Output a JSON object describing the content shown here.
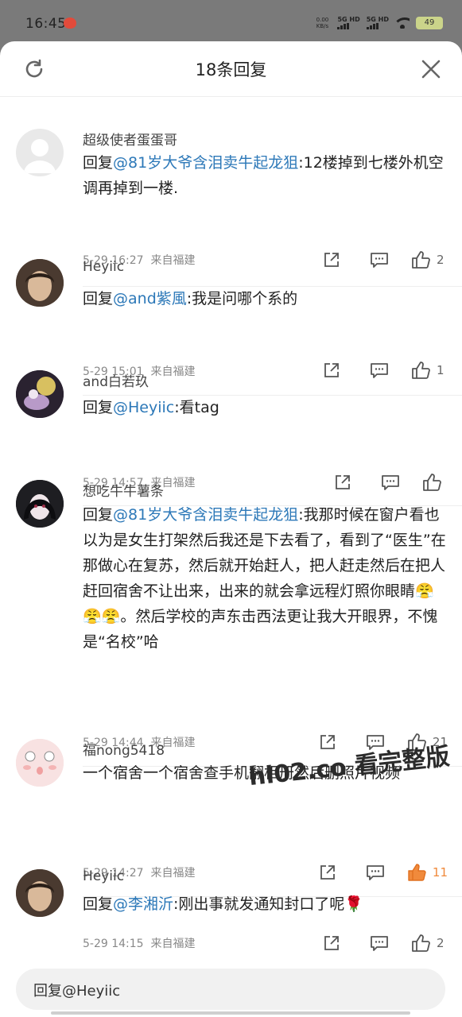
{
  "status_bar": {
    "time": "16:45",
    "net_speed_top": "0.00",
    "net_speed_unit": "KB/s",
    "sim1": "5G HD",
    "sim2": "5G HD",
    "battery": "49"
  },
  "sheet": {
    "title": "18条回复"
  },
  "comments": [
    {
      "username": "超级使者蛋蛋哥",
      "reply_prefix": "回复",
      "mention": "@81岁大爷含泪卖牛起龙狙",
      "text": ":12楼掉到七楼外机空调再掉到一楼.",
      "time": "5-29 16:27",
      "source": "来自福建",
      "likes": "2",
      "liked": false
    },
    {
      "username": "Heyiic",
      "reply_prefix": "回复",
      "mention": "@and紫風",
      "text": ":我是问哪个系的",
      "time": "5-29 15:01",
      "source": "来自福建",
      "likes": "1",
      "liked": false
    },
    {
      "username": "and白若玖",
      "reply_prefix": "回复",
      "mention": "@Heyiic",
      "text": ":看tag",
      "time": "5-29 14:57",
      "source": "来自福建",
      "likes": "",
      "liked": false
    },
    {
      "username": "想吃牛牛薯条",
      "reply_prefix": "回复",
      "mention": "@81岁大爷含泪卖牛起龙狙",
      "text": ":我那时候在窗户看也以为是女生打架然后我还是下去看了，看到了“医生”在那做心在复苏，然后就开始赶人，把人赶走然后在把人赶回宿舍不让出来，出来的就会拿远程灯照你眼睛😤😤😤。然后学校的声东击西法更让我大开眼界，不愧是“名校”哈",
      "time": "5-29 14:44",
      "source": "来自福建",
      "likes": "21",
      "liked": false
    },
    {
      "username": "福nong5418",
      "reply_prefix": "",
      "mention": "",
      "text": "一个宿舍一个宿舍查手机翻相册然后删照片视频",
      "time": "5-29 14:27",
      "source": "来自福建",
      "likes": "11",
      "liked": true
    },
    {
      "username": "Heyiic",
      "reply_prefix": "回复",
      "mention": "@李湘沂",
      "text": ":刚出事就发通知封口了呢🌹",
      "time": "5-29 14:15",
      "source": "来自福建",
      "likes": "2",
      "liked": false
    }
  ],
  "reply_box": {
    "placeholder": "回复@Heyiic"
  },
  "watermark": "hl02.co 看完整版",
  "colors": {
    "mention": "#2c78b8",
    "like_active": "#f08a3c"
  },
  "icons": [
    "refresh-icon",
    "close-icon",
    "share-icon",
    "comment-icon",
    "like-icon"
  ]
}
